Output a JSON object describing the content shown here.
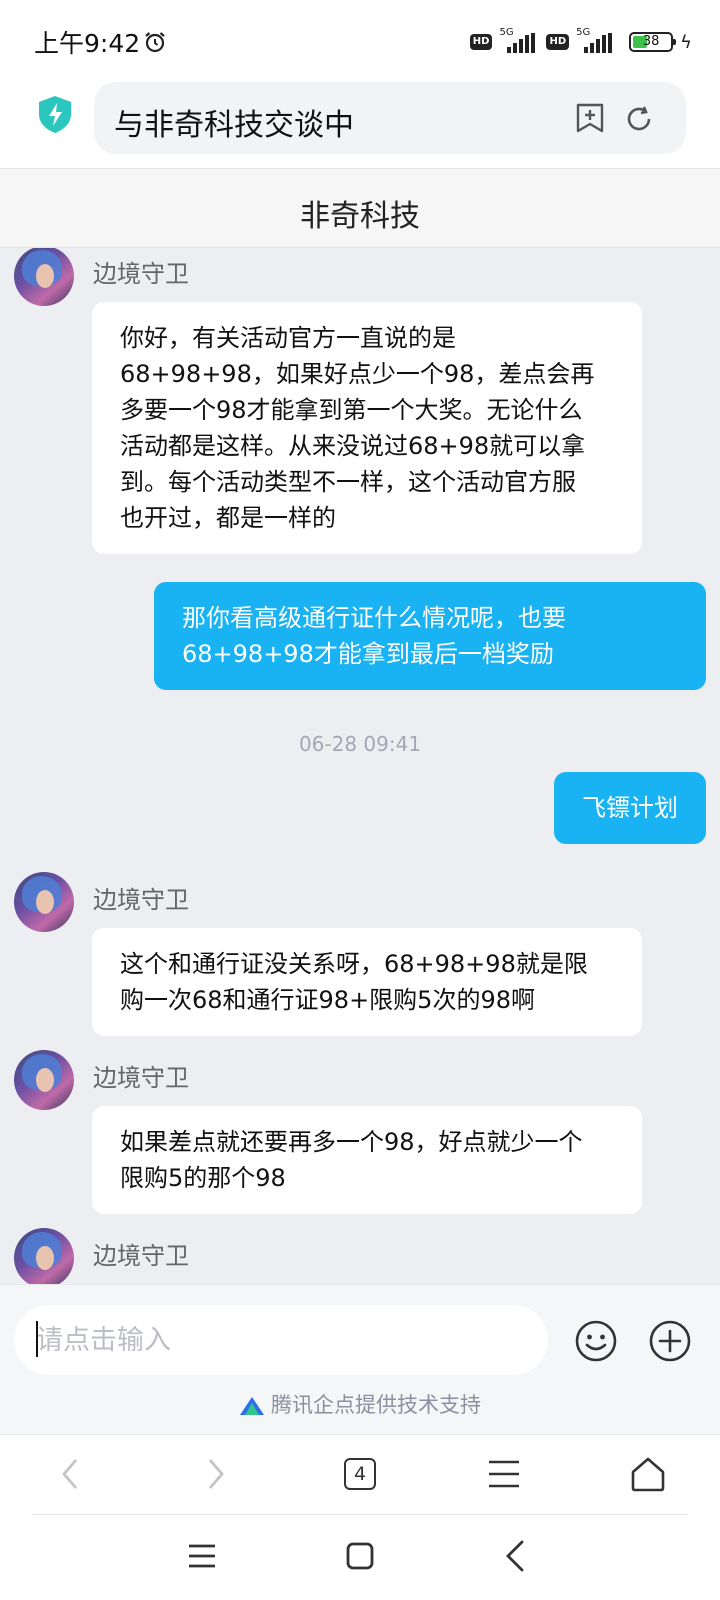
{
  "status_bar": {
    "time": "上午9:42",
    "network_1": "5G",
    "network_2": "5G",
    "hd_label": "HD",
    "battery_level": "38",
    "battery_fraction": 0.38
  },
  "address_bar": {
    "title": "与非奇科技交谈中",
    "icons": [
      "shield-bolt-icon",
      "add-bookmark-icon",
      "refresh-icon"
    ]
  },
  "chat": {
    "title": "非奇科技",
    "messages": [
      {
        "direction": "in",
        "sender": "边境守卫",
        "lines": [
          "你好，有关活动官方一直说的是",
          "68+98+98，如果好点少一个98，差点会再",
          "多要一个98才能拿到第一个大奖。无论什么",
          "活动都是这样。从来没说过68+98就可以拿",
          "到。每个活动类型不一样，这个活动官方服",
          "也开过，都是一样的"
        ]
      },
      {
        "direction": "out",
        "lines": [
          "那你看高级通行证什么情况呢，也要",
          "68+98+98才能拿到最后一档奖励"
        ]
      },
      {
        "type": "time",
        "text": "06-28 09:41"
      },
      {
        "direction": "out",
        "lines": [
          "飞镖计划"
        ]
      },
      {
        "direction": "in",
        "sender": "边境守卫",
        "lines": [
          "这个和通行证没关系呀，68+98+98就是限",
          "购一次68和通行证98+限购5次的98啊"
        ]
      },
      {
        "direction": "in",
        "sender": "边境守卫",
        "lines": [
          "如果差点就还要再多一个98，好点就少一个",
          "限购5的那个98"
        ]
      },
      {
        "direction": "in",
        "sender": "边境守卫",
        "lines": []
      }
    ]
  },
  "input": {
    "placeholder": "请点击输入",
    "value": ""
  },
  "powered_by": "腾讯企点提供技术支持",
  "browser_nav": {
    "tab_count": "4",
    "icons": [
      "back-icon",
      "forward-icon",
      "tabs-icon",
      "menu-icon",
      "home-icon"
    ]
  },
  "system_nav": {
    "icons": [
      "recents-icon",
      "home-button-icon",
      "back-button-icon"
    ]
  },
  "colors": {
    "outgoing_bubble": "#19b2f2",
    "chat_background": "#eceef2",
    "shield": "#2bc7bf"
  }
}
